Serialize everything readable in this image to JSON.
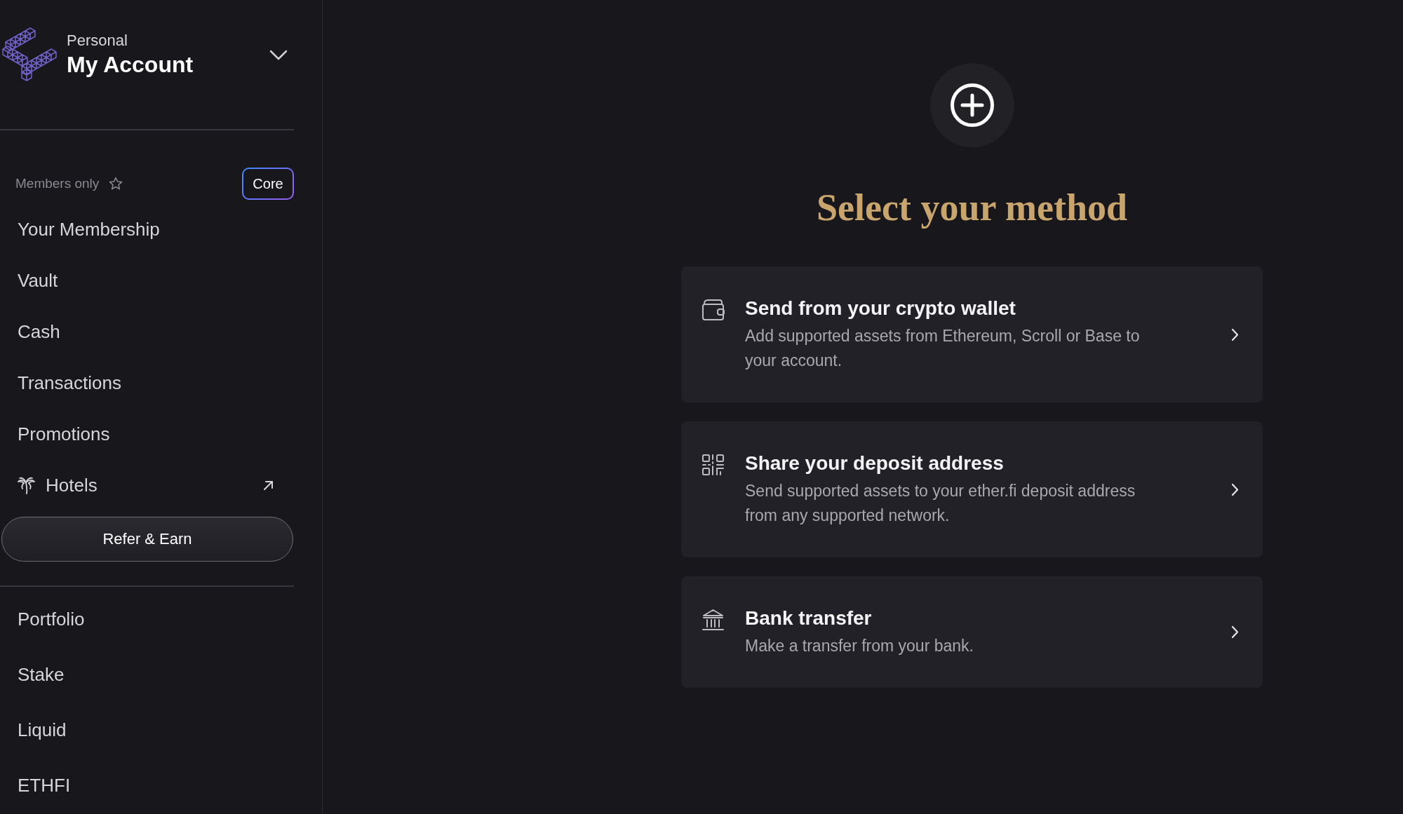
{
  "sidebar": {
    "account": {
      "context": "Personal",
      "name": "My Account"
    },
    "members": {
      "label": "Members only",
      "badge": "Core"
    },
    "nav_items": [
      {
        "label": "Your Membership",
        "kind": "link"
      },
      {
        "label": "Vault",
        "kind": "link"
      },
      {
        "label": "Cash",
        "kind": "link"
      },
      {
        "label": "Transactions",
        "kind": "link"
      },
      {
        "label": "Promotions",
        "kind": "link"
      },
      {
        "label": "Hotels",
        "kind": "external"
      }
    ],
    "refer_button": "Refer & Earn",
    "secondary_items": [
      {
        "label": "Portfolio"
      },
      {
        "label": "Stake"
      },
      {
        "label": "Liquid"
      },
      {
        "label": "ETHFI"
      }
    ]
  },
  "main": {
    "title": "Select your method",
    "methods": [
      {
        "kind": "wallet",
        "title": "Send from your crypto wallet",
        "description": "Add supported assets from Ethereum, Scroll or Base to your account."
      },
      {
        "kind": "qr",
        "title": "Share your deposit address",
        "description": "Send supported assets to your ether.fi deposit address from any supported network."
      },
      {
        "kind": "bank",
        "title": "Bank transfer",
        "description": "Make a transfer from your bank."
      }
    ]
  }
}
